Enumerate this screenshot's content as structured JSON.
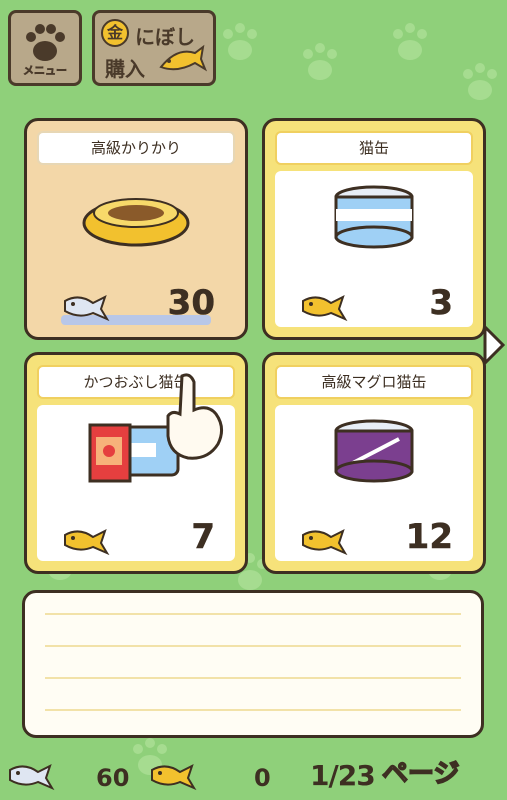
{
  "header": {
    "menu_label": "メニュー",
    "gold_badge": "金",
    "gold_line1": "にぼし",
    "gold_line2": "購入"
  },
  "items": [
    {
      "name": "高級かりかり",
      "price": "30",
      "currency": "silver",
      "selected": true
    },
    {
      "name": "猫缶",
      "price": "3",
      "currency": "gold",
      "selected": false
    },
    {
      "name": "かつおぶし猫缶",
      "price": "7",
      "currency": "gold",
      "selected": false
    },
    {
      "name": "高級マグロ猫缶",
      "price": "12",
      "currency": "gold",
      "selected": false
    }
  ],
  "footer": {
    "silver_count": "60",
    "gold_count": "0",
    "page": "1/23",
    "page_label": "ページ"
  },
  "colors": {
    "background": "#8fd07a",
    "card_gold": "#f6e27a",
    "card_selected": "#f3d7a8",
    "outline": "#3d2f22"
  }
}
